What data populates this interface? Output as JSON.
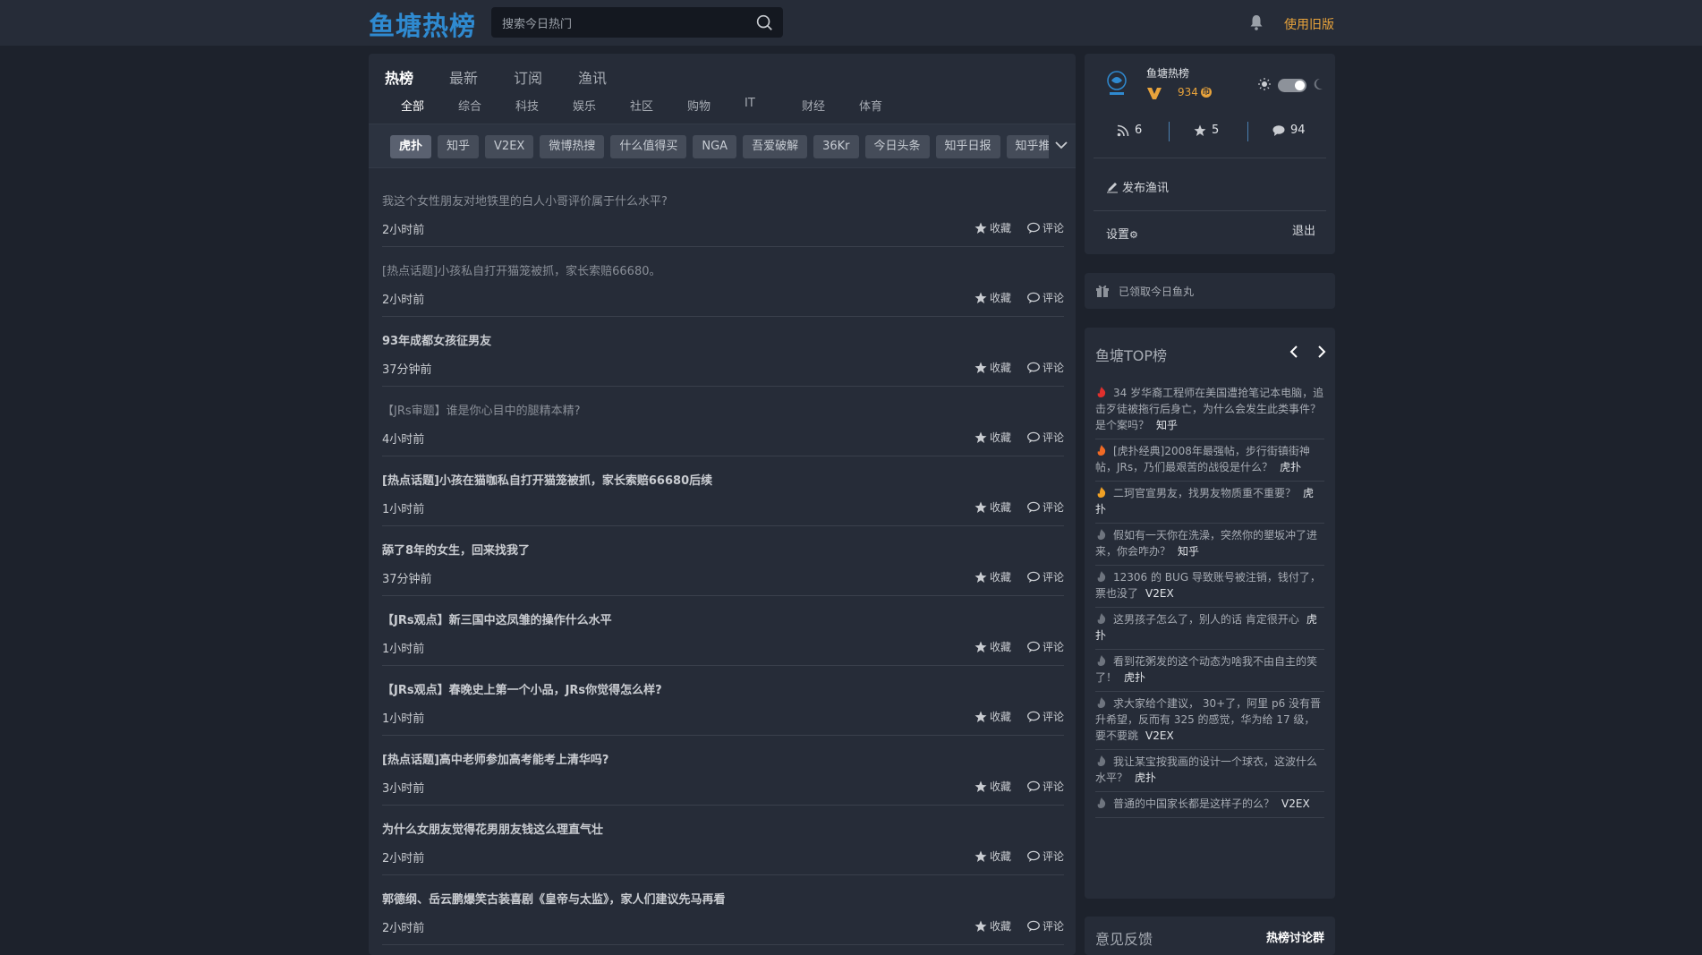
{
  "header": {
    "logo": "鱼塘热榜",
    "search_placeholder": "搜索今日热门",
    "old_version": "使用旧版"
  },
  "main": {
    "tabs": [
      "热榜",
      "最新",
      "订阅",
      "渔讯"
    ],
    "subtabs": [
      "全部",
      "综合",
      "科技",
      "娱乐",
      "社区",
      "购物",
      "IT",
      "财经",
      "体育"
    ],
    "sources": [
      "虎扑",
      "知乎",
      "V2EX",
      "微博热搜",
      "什么值得买",
      "NGA",
      "吾爱破解",
      "36Kr",
      "今日头条",
      "知乎日报",
      "知乎推荐"
    ],
    "items": [
      {
        "title": "我这个女性朋友对地铁里的白人小哥评价属于什么水平?",
        "time": "2小时前",
        "visited": true
      },
      {
        "title": "[热点话题]小孩私自打开猫笼被抓，家长索赔66680。",
        "time": "2小时前",
        "visited": true
      },
      {
        "title": "93年成都女孩征男友",
        "time": "37分钟前",
        "visited": false
      },
      {
        "title": "【JRs审题】谁是你心目中的腿精本精?",
        "time": "4小时前",
        "visited": true
      },
      {
        "title": "[热点话题]小孩在猫咖私自打开猫笼被抓，家长索赔66680后续",
        "time": "1小时前",
        "visited": false
      },
      {
        "title": "舔了8年的女生，回来找我了",
        "time": "37分钟前",
        "visited": false
      },
      {
        "title": "【JRs观点】新三国中这凤雏的操作什么水平",
        "time": "1小时前",
        "visited": false
      },
      {
        "title": "【JRs观点】春晚史上第一个小品，JRs你觉得怎么样?",
        "time": "1小时前",
        "visited": false
      },
      {
        "title": "[热点话题]高中老师参加高考能考上清华吗?",
        "time": "3小时前",
        "visited": false
      },
      {
        "title": "为什么女朋友觉得花男朋友钱这么理直气壮",
        "time": "2小时前",
        "visited": false
      },
      {
        "title": "郭德纲、岳云鹏爆笑古装喜剧《皇帝与太监》，家人们建议先马再看",
        "time": "2小时前",
        "visited": false
      }
    ],
    "fav_label": "收藏",
    "comment_label": "评论"
  },
  "profile": {
    "name": "鱼塘热榜",
    "coins": "934",
    "coin_symbol": "币",
    "rss": "6",
    "stars": "5",
    "comments": "94",
    "publish": "发布渔讯",
    "settings": "设置",
    "logout": "退出"
  },
  "gift": {
    "text": "已领取今日鱼丸"
  },
  "top": {
    "heading": "鱼塘TOP榜",
    "items": [
      {
        "title": "34 岁华裔工程师在美国遭抢笔记本电脑，追击歹徒被拖行后身亡，为什么会发生此类事件？是个案吗？",
        "source": "知乎",
        "fire": "#e0302d"
      },
      {
        "title": "[虎扑经典]2008年最强帖，步行街镇街神帖，JRs，乃们最艰苦的战役是什么？",
        "source": "虎扑",
        "fire": "#f06a25"
      },
      {
        "title": "二珂官宣男友，找男友物质重不重要？",
        "source": "虎扑",
        "fire": "#f0a125"
      },
      {
        "title": "假如有一天你在洗澡，突然你的墾坂冲了进来，你会咋办？",
        "source": "知乎",
        "fire": "#6e747e"
      },
      {
        "title": "12306 的 BUG 导致账号被注销，钱付了，票也没了",
        "source": "V2EX",
        "fire": "#6e747e"
      },
      {
        "title": "这男孩子怎么了，别人的话 肯定很开心",
        "source": "虎扑",
        "fire": "#6e747e"
      },
      {
        "title": "看到花粥发的这个动态为啥我不由自主的笑了！",
        "source": "虎扑",
        "fire": "#6e747e"
      },
      {
        "title": "求大家给个建议， 30+了，阿里 p6 没有晋升希望，反而有 325 的感觉，华为给 17 级，要不要跳",
        "source": "V2EX",
        "fire": "#6e747e"
      },
      {
        "title": "我让某宝按我画的设计一个球衣，这波什么水平？",
        "source": "虎扑",
        "fire": "#6e747e"
      },
      {
        "title": "普通的中国家长都是这样子的么？",
        "source": "V2EX",
        "fire": "#6e747e"
      }
    ]
  },
  "feedback": {
    "left": "意见反馈",
    "right": "热榜讨论群"
  }
}
